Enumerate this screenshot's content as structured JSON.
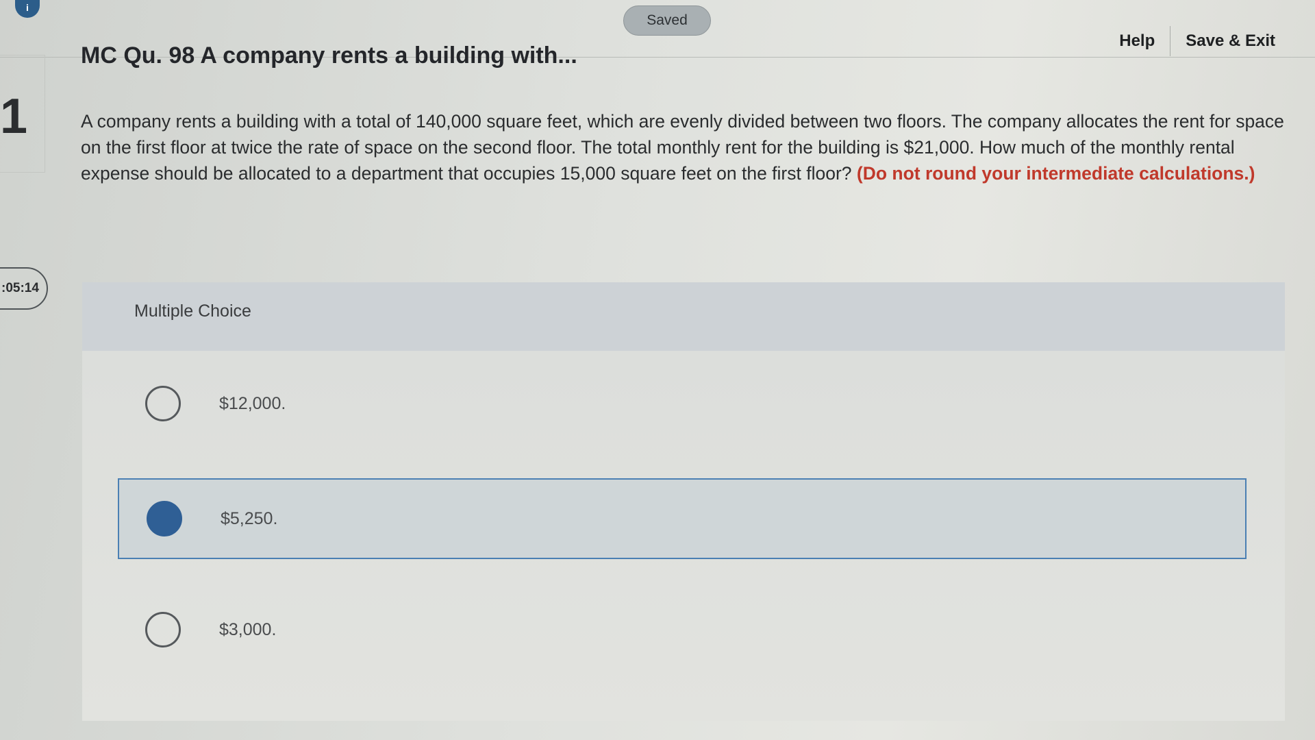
{
  "topbar": {
    "info_badge": "i",
    "saved_label": "Saved",
    "help_label": "Help",
    "save_exit_label": "Save & Exit"
  },
  "left_rail": {
    "question_number": "1",
    "timer": ":05:14"
  },
  "question": {
    "title": "MC Qu. 98 A company rents a building with...",
    "body": "A company rents a building with a total of 140,000 square feet, which are evenly divided between two floors. The company allocates the rent for space on the first floor at twice the rate of space on the second floor. The total monthly rent for the building is $21,000. How much of the monthly rental expense should be allocated to a department that occupies 15,000 square feet on the first floor?",
    "note": "(Do not round your intermediate calculations.)"
  },
  "multiple_choice": {
    "label": "Multiple Choice",
    "choices": [
      {
        "text": "$12,000.",
        "selected": false
      },
      {
        "text": "$5,250.",
        "selected": true
      },
      {
        "text": "$3,000.",
        "selected": false
      }
    ]
  },
  "colors": {
    "accent": "#2f5f95",
    "note_red": "#c0392b"
  }
}
